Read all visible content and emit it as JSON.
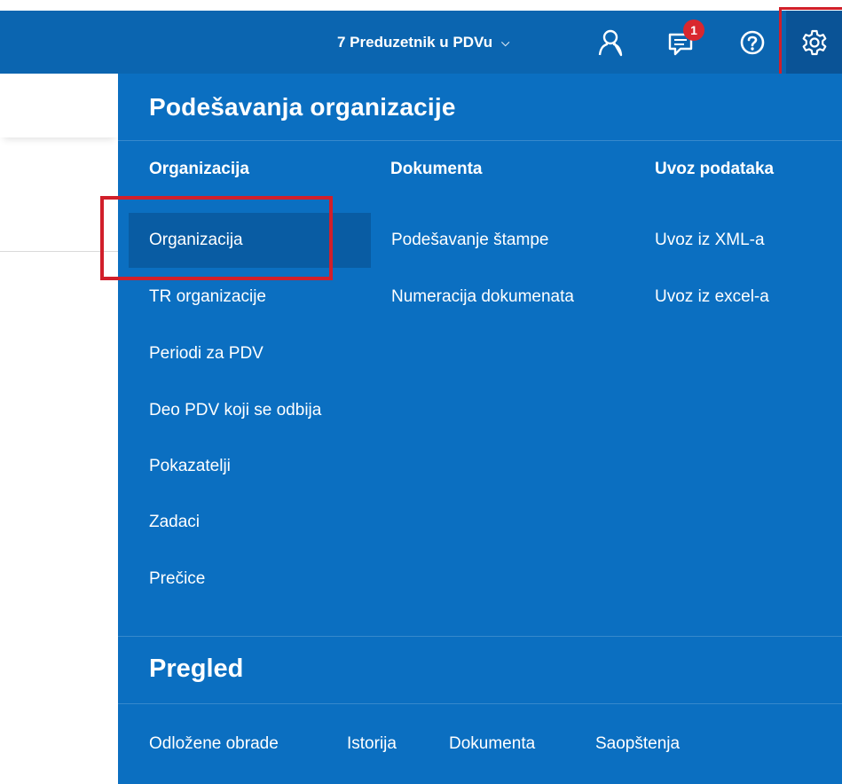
{
  "header": {
    "org_name": "7 Preduzetnik u PDVu",
    "notification_count": "1"
  },
  "settings_panel": {
    "title": "Podešavanja organizacije",
    "columns": [
      {
        "heading": "Organizacija",
        "items": [
          "Organizacija",
          "TR organizacije",
          "Periodi za PDV",
          "Deo PDV koji se odbija",
          "Pokazatelji",
          "Zadaci",
          "Prečice"
        ],
        "active_item": "Organizacija"
      },
      {
        "heading": "Dokumenta",
        "items": [
          "Podešavanje štampe",
          "Numeracija dokumenata"
        ]
      },
      {
        "heading": "Uvoz podataka",
        "items": [
          "Uvoz iz XML-a",
          "Uvoz iz excel-a"
        ]
      }
    ]
  },
  "pregled": {
    "title": "Pregled",
    "links": [
      "Odložene obrade",
      "Istorija",
      "Dokumenta",
      "Saopštenja"
    ]
  },
  "colors": {
    "topbar": "#0b65b0",
    "panel": "#0b6fc1",
    "active_item": "#095ca3",
    "highlight": "#d11f2a",
    "badge": "#d9272e"
  },
  "icons": [
    "chevron-down-icon",
    "user-icon",
    "notifications-icon",
    "help-icon",
    "gear-icon"
  ]
}
